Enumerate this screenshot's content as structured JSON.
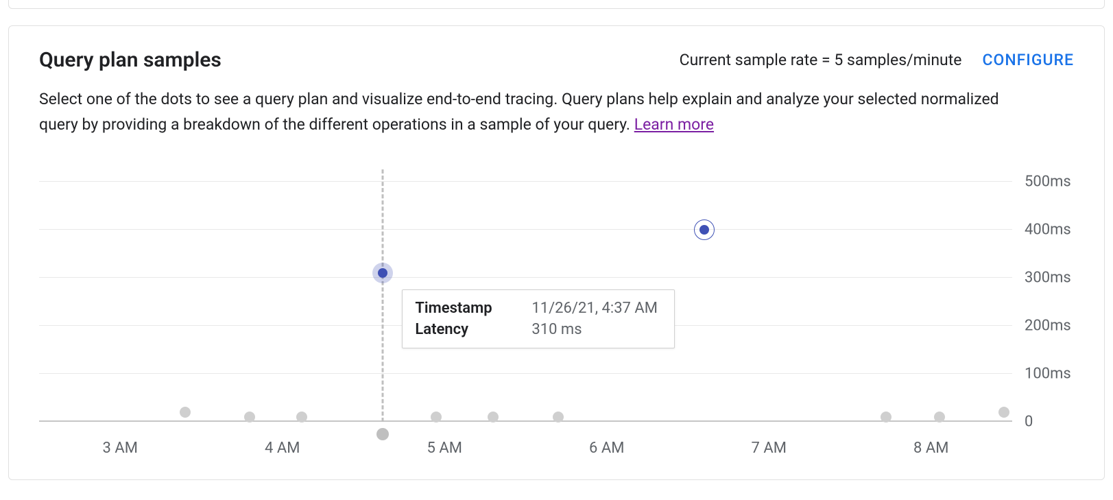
{
  "header": {
    "title": "Query plan samples",
    "sample_rate_text": "Current sample rate = 5 samples/minute",
    "configure_label": "CONFIGURE"
  },
  "description": {
    "text": "Select one of the dots to see a query plan and visualize end-to-end tracing. Query plans help explain and analyze your selected normalized query by providing a breakdown of the different operations in a sample of your query. ",
    "learn_more": "Learn more"
  },
  "tooltip": {
    "rows": [
      {
        "label": "Timestamp",
        "value": "11/26/21, 4:37 AM"
      },
      {
        "label": "Latency",
        "value": "310 ms"
      }
    ]
  },
  "chart_data": {
    "type": "scatter",
    "xlabel": "",
    "ylabel": "",
    "ylim": [
      0,
      500
    ],
    "y_ticks": [
      0,
      100,
      200,
      300,
      400,
      500
    ],
    "y_tick_labels": [
      "0",
      "100ms",
      "200ms",
      "300ms",
      "400ms",
      "500ms"
    ],
    "x_range_hours": [
      2.5,
      8.5
    ],
    "x_ticks": [
      3,
      4,
      5,
      6,
      7,
      8
    ],
    "x_tick_labels": [
      "3 AM",
      "4 AM",
      "5 AM",
      "6 AM",
      "7 AM",
      "8 AM"
    ],
    "points": [
      {
        "x": 3.4,
        "y": 20,
        "state": "normal"
      },
      {
        "x": 3.8,
        "y": 10,
        "state": "normal"
      },
      {
        "x": 4.12,
        "y": 10,
        "state": "normal"
      },
      {
        "x": 4.62,
        "y": 310,
        "state": "hover"
      },
      {
        "x": 4.95,
        "y": 10,
        "state": "normal"
      },
      {
        "x": 5.3,
        "y": 10,
        "state": "normal"
      },
      {
        "x": 5.7,
        "y": 10,
        "state": "normal"
      },
      {
        "x": 6.6,
        "y": 400,
        "state": "selected"
      },
      {
        "x": 7.72,
        "y": 10,
        "state": "normal"
      },
      {
        "x": 8.05,
        "y": 10,
        "state": "normal"
      },
      {
        "x": 8.45,
        "y": 20,
        "state": "normal"
      }
    ],
    "cursor_x": 4.62
  }
}
